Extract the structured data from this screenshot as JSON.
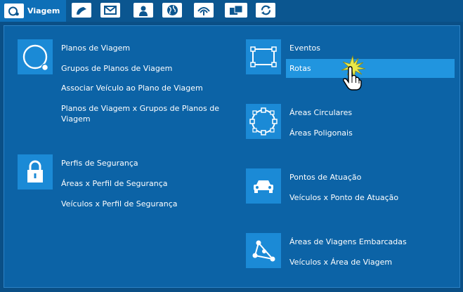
{
  "tabs": {
    "active_label": "Viagem",
    "icons": [
      "viagem-icon",
      "pen-icon",
      "mail-icon",
      "user-icon",
      "globe-icon",
      "signal-icon",
      "folder-icon",
      "sync-icon"
    ]
  },
  "groups": {
    "planos": {
      "icon": "ring-icon",
      "links": [
        "Planos de Viagem",
        "Grupos de Planos de Viagem",
        "Associar Veículo ao Plano de Viagem",
        "Planos de Viagem x Grupos de Planos de Viagem"
      ]
    },
    "seguranca": {
      "icon": "lock-icon",
      "links": [
        "Perfis de Segurança",
        "Áreas x Perfil de Segurança",
        "Veículos x Perfil de Segurança"
      ]
    },
    "eventos": {
      "icon": "rectangle-select-icon",
      "links": [
        "Eventos",
        "Rotas"
      ],
      "highlighted": "Rotas"
    },
    "areas": {
      "icon": "circle-select-icon",
      "links": [
        "Áreas Circulares",
        "Áreas Poligonais"
      ]
    },
    "atuacao": {
      "icon": "car-icon",
      "links": [
        "Pontos de Atuação",
        "Veículos x Ponto de Atuação"
      ]
    },
    "embarcadas": {
      "icon": "polygon-icon",
      "links": [
        "Áreas de Viagens Embarcadas",
        "Veículos x Área de Viagem"
      ]
    }
  },
  "colors": {
    "background": "#0a4f86",
    "panel": "#0c63a6",
    "icon_tile": "#1b8ad6",
    "highlight": "#2195df",
    "active_tab": "#0e6fb7"
  }
}
